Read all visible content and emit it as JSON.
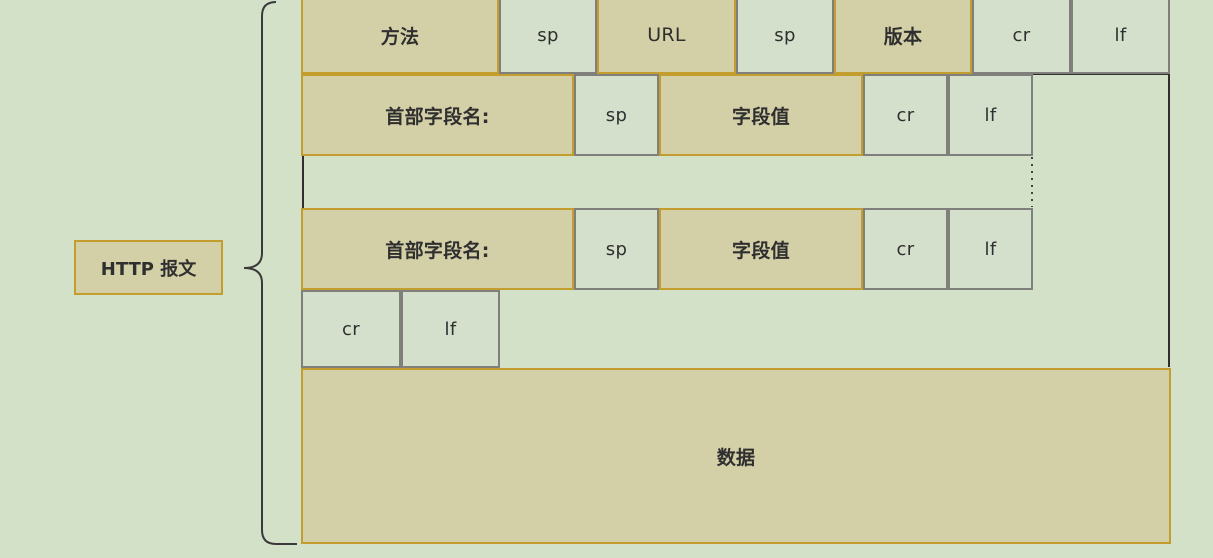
{
  "message_label": "HTTP 报文",
  "request_line": {
    "method": "方法",
    "sp1": "sp",
    "url": "URL",
    "sp2": "sp",
    "version": "版本",
    "cr": "cr",
    "lf": "lf"
  },
  "header_line_1": {
    "name": "首部字段名:",
    "sp": "sp",
    "value": "字段值",
    "cr": "cr",
    "lf": "lf"
  },
  "header_line_2": {
    "name": "首部字段名:",
    "sp": "sp",
    "value": "字段值",
    "cr": "cr",
    "lf": "lf"
  },
  "blank_line": {
    "cr": "cr",
    "lf": "lf"
  },
  "body": {
    "label": "数据"
  }
}
